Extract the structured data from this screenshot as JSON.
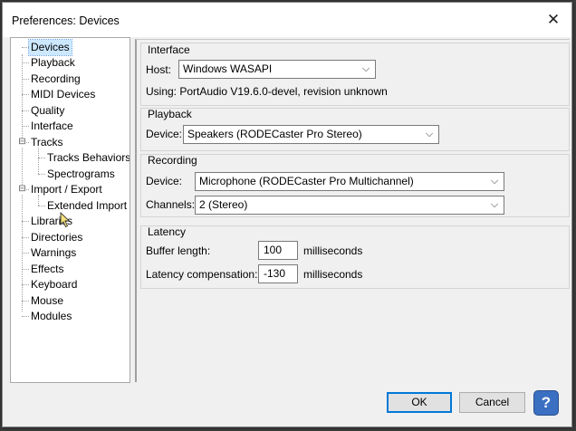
{
  "window": {
    "title": "Preferences: Devices",
    "close_glyph": "✕"
  },
  "tree": {
    "items": [
      {
        "label": "Devices"
      },
      {
        "label": "Playback"
      },
      {
        "label": "Recording"
      },
      {
        "label": "MIDI Devices"
      },
      {
        "label": "Quality"
      },
      {
        "label": "Interface"
      },
      {
        "label": "Tracks",
        "expander": "⊟"
      },
      {
        "label": "Tracks Behaviors"
      },
      {
        "label": "Spectrograms"
      },
      {
        "label": "Import / Export",
        "expander": "⊟"
      },
      {
        "label": "Extended Import"
      },
      {
        "label": "Libraries"
      },
      {
        "label": "Directories"
      },
      {
        "label": "Warnings"
      },
      {
        "label": "Effects"
      },
      {
        "label": "Keyboard"
      },
      {
        "label": "Mouse"
      },
      {
        "label": "Modules"
      }
    ],
    "selected": "Devices"
  },
  "interface": {
    "heading": "Interface",
    "host_label": "Host:",
    "host_value": "Windows WASAPI",
    "using_text": "Using: PortAudio V19.6.0-devel, revision unknown"
  },
  "playback": {
    "heading": "Playback",
    "device_label": "Device:",
    "device_value": "Speakers (RODECaster Pro Stereo)"
  },
  "recording": {
    "heading": "Recording",
    "device_label": "Device:",
    "device_value": "Microphone (RODECaster Pro Multichannel)",
    "channels_label": "Channels:",
    "channels_value": "2 (Stereo)"
  },
  "latency": {
    "heading": "Latency",
    "buffer_label": "Buffer length:",
    "buffer_value": "100",
    "buffer_unit": "milliseconds",
    "comp_label": "Latency compensation:",
    "comp_value": "-130",
    "comp_unit": "milliseconds"
  },
  "buttons": {
    "ok": "OK",
    "cancel": "Cancel",
    "help": "?"
  },
  "colors": {
    "selection": "#cce8ff",
    "help_button": "#3b6fc1",
    "default_border": "#0078d7"
  }
}
